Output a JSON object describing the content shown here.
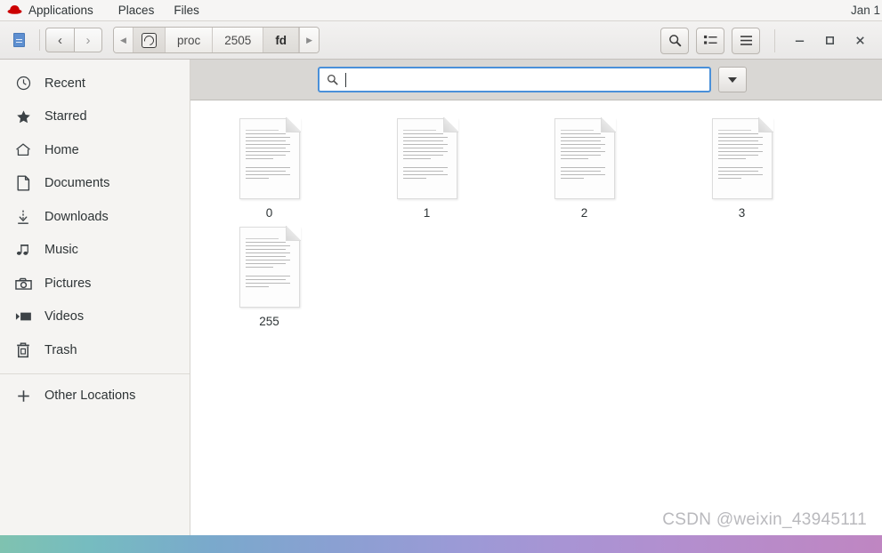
{
  "gnome_bar": {
    "logo_icon": "redhat-fedora-icon",
    "menus": [
      {
        "label": "Applications"
      },
      {
        "label": "Places"
      },
      {
        "label": "Files"
      }
    ],
    "clock": "Jan 1"
  },
  "window": {
    "headerbar": {
      "sidebar_toggle_icon": "document-blue-icon",
      "nav": {
        "back_icon": "chevron-left-icon",
        "back_glyph": "‹",
        "forward_icon": "chevron-right-icon",
        "forward_glyph": "›"
      },
      "pathbar": {
        "scroll_left_glyph": "◀",
        "scroll_right_glyph": "▶",
        "crumbs": [
          {
            "label": "",
            "icon": "disk-drive-icon",
            "is_icon": true,
            "current": false
          },
          {
            "label": "proc",
            "current": false
          },
          {
            "label": "2505",
            "current": false
          },
          {
            "label": "fd",
            "current": true
          }
        ]
      },
      "toolbuttons": [
        {
          "name": "search-button",
          "icon": "search-icon"
        },
        {
          "name": "view-list-button",
          "icon": "list-view-icon"
        },
        {
          "name": "menu-button",
          "icon": "hamburger-menu-icon"
        }
      ],
      "window_controls": [
        {
          "name": "minimize-button",
          "icon": "minimize-icon",
          "glyph": "—"
        },
        {
          "name": "maximize-button",
          "icon": "maximize-icon",
          "glyph": "□"
        },
        {
          "name": "close-button",
          "icon": "close-icon",
          "glyph": "×"
        }
      ]
    },
    "sidebar": {
      "items": [
        {
          "label": "Recent",
          "icon": "clock-icon"
        },
        {
          "label": "Starred",
          "icon": "star-icon"
        },
        {
          "label": "Home",
          "icon": "home-icon"
        },
        {
          "label": "Documents",
          "icon": "document-icon"
        },
        {
          "label": "Downloads",
          "icon": "download-arrow-icon"
        },
        {
          "label": "Music",
          "icon": "music-note-icon"
        },
        {
          "label": "Pictures",
          "icon": "camera-icon"
        },
        {
          "label": "Videos",
          "icon": "video-icon"
        },
        {
          "label": "Trash",
          "icon": "trash-icon"
        }
      ],
      "other": {
        "label": "Other Locations",
        "icon": "plus-icon"
      }
    },
    "search": {
      "icon": "search-icon",
      "value": "",
      "placeholder": "",
      "dropdown_icon": "chevron-down-icon"
    },
    "files": [
      {
        "name": "0",
        "icon": "text-document-icon"
      },
      {
        "name": "1",
        "icon": "text-document-icon"
      },
      {
        "name": "2",
        "icon": "text-document-icon"
      },
      {
        "name": "3",
        "icon": "text-document-icon"
      },
      {
        "name": "255",
        "icon": "text-document-icon"
      }
    ]
  },
  "watermark": {
    "text": "CSDN @weixin_43945111"
  },
  "colors": {
    "accent": "#4a90d9",
    "gnome_bar_bg": "#f6f5f4",
    "sidebar_bg": "#f5f4f2",
    "searchbar_bg": "#d9d7d4",
    "redhat_red": "#cc0000"
  }
}
